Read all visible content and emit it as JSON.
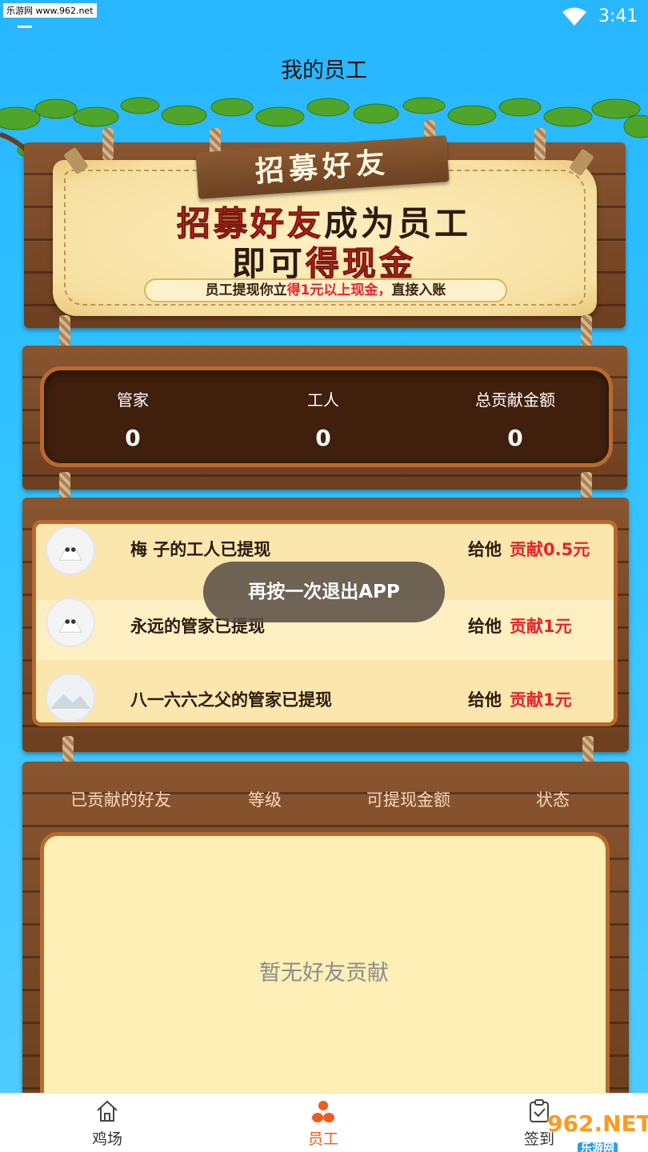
{
  "status_bar": {
    "watermark": "乐游网 www.962.net",
    "time": "3:41"
  },
  "header": {
    "title": "我的员工"
  },
  "banner": {
    "ribbon": "招募好友",
    "line1_a": "招募好友",
    "line1_b": "成为员工",
    "line2_a": "即可",
    "line2_b": "得现金",
    "pill_a": "员工提现你立",
    "pill_b": "得1元以上现金，",
    "pill_c": "直接入账"
  },
  "stats": [
    {
      "label": "管家",
      "value": "0"
    },
    {
      "label": "工人",
      "value": "0"
    },
    {
      "label": "总贡献金额",
      "value": "0"
    }
  ],
  "feed": [
    {
      "text": "梅 子的工人已提现",
      "give": "给他",
      "contrib": "贡献0.5元"
    },
    {
      "text": "永远的管家已提现",
      "give": "给他",
      "contrib": "贡献1元"
    },
    {
      "text": "八一六六之父的管家已提现",
      "give": "给他",
      "contrib": "贡献1元"
    }
  ],
  "toast": "再按一次退出APP",
  "friends_table": {
    "columns": [
      "已贡献的好友",
      "等级",
      "可提现金额",
      "状态"
    ],
    "empty": "暂无好友贡献"
  },
  "bottom_nav": {
    "items": [
      {
        "label": "鸡场",
        "icon": "home-icon"
      },
      {
        "label": "员工",
        "icon": "employees-icon",
        "active": true
      },
      {
        "label": "签到",
        "icon": "checkin-icon"
      }
    ]
  },
  "watermark_br": {
    "brand": "962.NET",
    "sub": "乐游网"
  },
  "colors": {
    "accent": "#f25a1d",
    "sky": "#34c4ff",
    "wood": "#7a4a28",
    "red": "#e9232a"
  }
}
